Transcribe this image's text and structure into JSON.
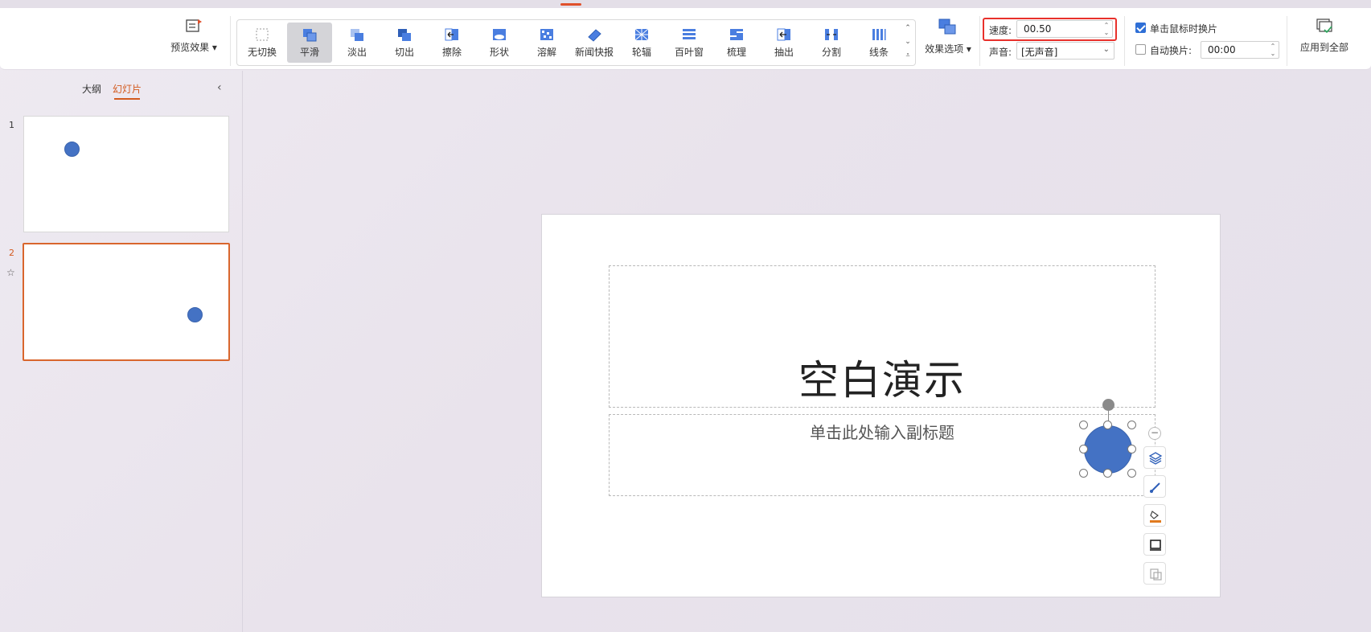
{
  "ribbon": {
    "preview_label": "预览效果",
    "transitions": [
      {
        "label": "无切换",
        "icon": "no-transition-icon"
      },
      {
        "label": "平滑",
        "icon": "smooth-icon",
        "selected": true
      },
      {
        "label": "淡出",
        "icon": "fade-icon"
      },
      {
        "label": "切出",
        "icon": "cut-icon"
      },
      {
        "label": "擦除",
        "icon": "wipe-icon"
      },
      {
        "label": "形状",
        "icon": "shape-icon"
      },
      {
        "label": "溶解",
        "icon": "dissolve-icon"
      },
      {
        "label": "新闻快报",
        "icon": "newsflash-icon"
      },
      {
        "label": "轮辐",
        "icon": "wheel-icon"
      },
      {
        "label": "百叶窗",
        "icon": "blinds-icon"
      },
      {
        "label": "梳理",
        "icon": "comb-icon"
      },
      {
        "label": "抽出",
        "icon": "pull-icon"
      },
      {
        "label": "分割",
        "icon": "split-icon"
      },
      {
        "label": "线条",
        "icon": "lines-icon"
      }
    ],
    "effect_options_label": "效果选项",
    "speed_label": "速度:",
    "speed_value": "00.50",
    "sound_label": "声音:",
    "sound_value": "[无声音]",
    "on_click_label": "单击鼠标时换片",
    "on_click_checked": true,
    "auto_label": "自动换片:",
    "auto_checked": false,
    "auto_value": "00:00",
    "apply_all_label": "应用到全部",
    "accent_color": "#e8302b"
  },
  "panel": {
    "tab_outline": "大纲",
    "tab_slides": "幻灯片",
    "slides": [
      {
        "number": "1"
      },
      {
        "number": "2"
      }
    ]
  },
  "slide": {
    "title": "空白演示",
    "subtitle": "单击此处输入副标题",
    "shape_color": "#4472c4"
  }
}
